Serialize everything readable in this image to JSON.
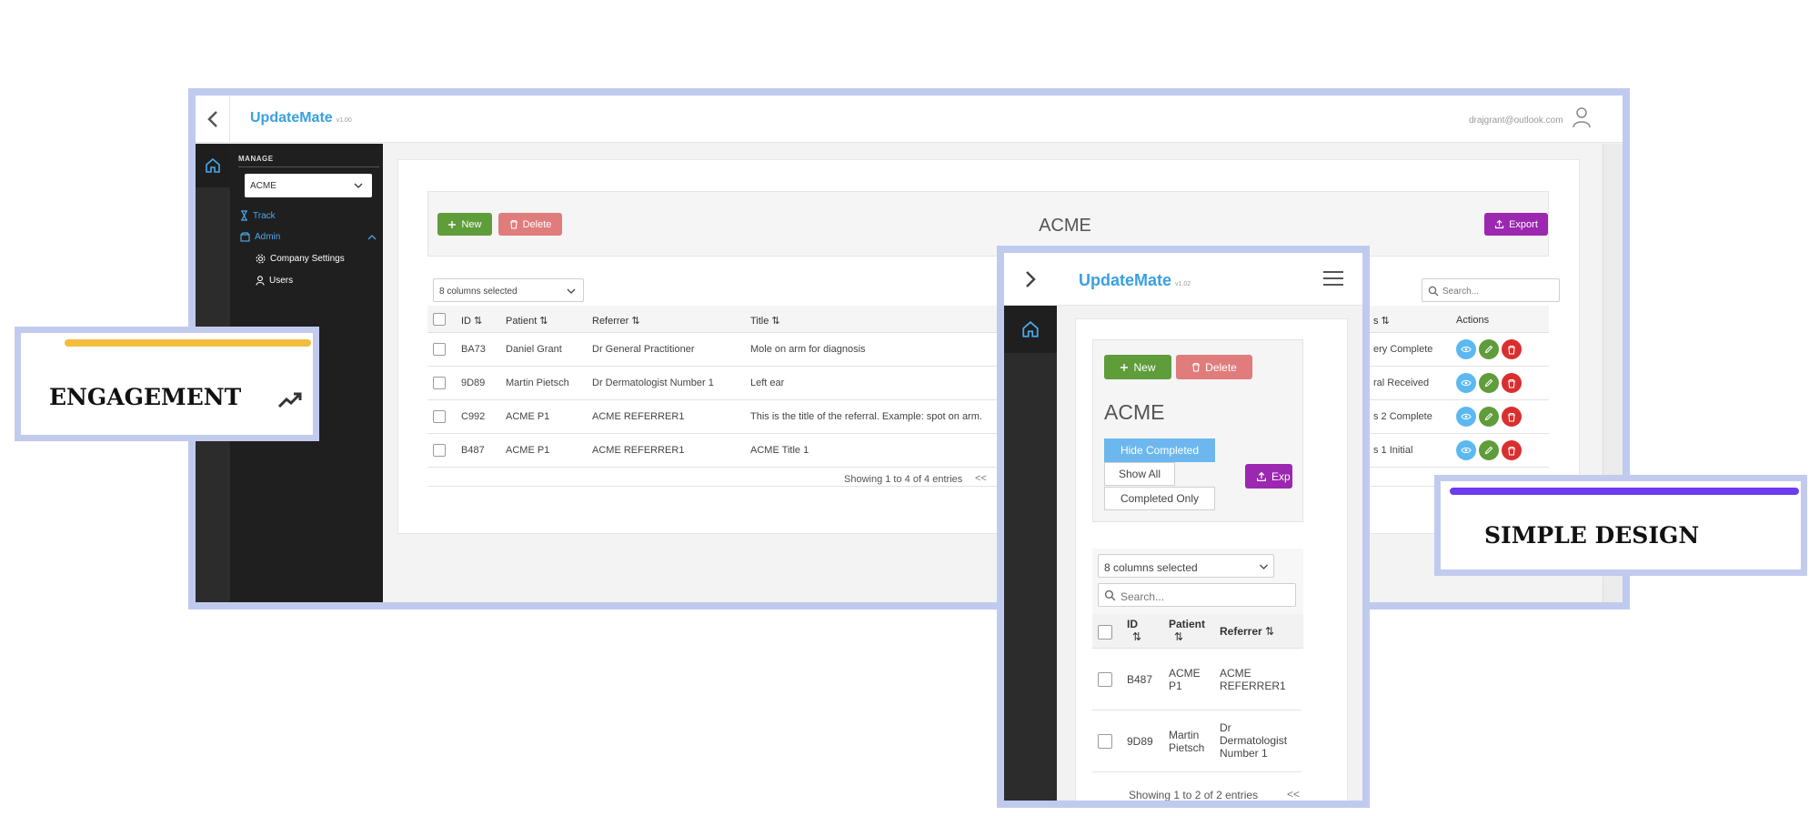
{
  "desktop": {
    "brand": "UpdateMate",
    "version": "v1.00",
    "user_email": "drajgrant@outlook.com",
    "sidebar": {
      "section_label": "MANAGE",
      "company_select": "ACME",
      "items": [
        {
          "label": "Track"
        },
        {
          "label": "Admin"
        },
        {
          "label": "Company Settings"
        },
        {
          "label": "Users"
        }
      ]
    },
    "toolbar": {
      "new_label": "New",
      "delete_label": "Delete",
      "title": "ACME",
      "export_label": "Export"
    },
    "table": {
      "columns_select": "8 columns selected",
      "search_placeholder": "Search...",
      "headers": {
        "id": "ID",
        "patient": "Patient",
        "referrer": "Referrer",
        "title": "Title",
        "status": "s",
        "actions": "Actions"
      },
      "rows": [
        {
          "id": "BA73",
          "patient": "Daniel Grant",
          "referrer": "Dr General Practitioner",
          "title": "Mole on arm for diagnosis",
          "status": "ery Complete"
        },
        {
          "id": "9D89",
          "patient": "Martin Pietsch",
          "referrer": "Dr Dermatologist Number 1",
          "title": "Left ear",
          "status": "ral Received"
        },
        {
          "id": "C992",
          "patient": "ACME P1",
          "referrer": "ACME REFERRER1",
          "title": "This is the title of the referral. Example: spot on arm.",
          "status": "s 2 Complete"
        },
        {
          "id": "B487",
          "patient": "ACME P1",
          "referrer": "ACME REFERRER1",
          "title": "ACME Title 1",
          "status": "s 1 Initial"
        }
      ],
      "footer": "Showing 1 to 4 of 4 entries",
      "pager_first": "<<"
    }
  },
  "mobile": {
    "brand": "UpdateMate",
    "version": "v1.02",
    "toolbar": {
      "new_label": "New",
      "delete_label": "Delete",
      "title": "ACME",
      "hide_completed": "Hide Completed",
      "show_all": "Show All",
      "completed_only": "Completed Only",
      "export_partial": "Exp"
    },
    "table": {
      "columns_select": "8 columns selected",
      "search_placeholder": "Search...",
      "headers": {
        "id": "ID",
        "patient": "Patient",
        "referrer": "Referrer"
      },
      "rows": [
        {
          "id": "B487",
          "patient_l1": "ACME",
          "patient_l2": "P1",
          "referrer_l1": "ACME",
          "referrer_l2": "REFERRER1",
          "referrer_l3": ""
        },
        {
          "id": "9D89",
          "patient_l1": "Martin",
          "patient_l2": "Pietsch",
          "referrer_l1": "Dr",
          "referrer_l2": "Dermatologist",
          "referrer_l3": "Number 1"
        }
      ],
      "footer": "Showing 1 to 2 of 2 entries",
      "pager_first": "<<"
    }
  },
  "callouts": {
    "engagement": {
      "label": "ENGAGEMENT",
      "bar_color": "#f3bd3c"
    },
    "simple_design": {
      "label": "SIMPLE DESIGN",
      "bar_color": "#6b3cf0"
    }
  },
  "colors": {
    "brand": "#39a0e0",
    "frame": "#bfcbee",
    "new": "#5f9c3a",
    "delete": "#e07c7c",
    "export": "#9c27b0",
    "view": "#5bb8f0",
    "edit": "#5f9c3a",
    "remove": "#d92f2f"
  }
}
